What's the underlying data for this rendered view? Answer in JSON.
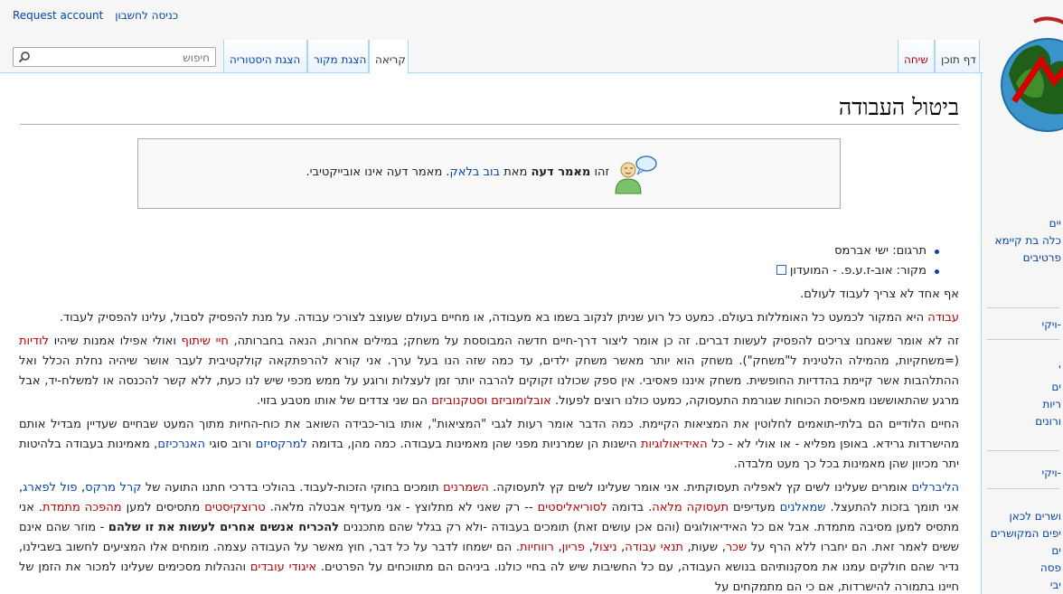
{
  "personal": {
    "login": "כניסה לחשבון",
    "request": "Request account"
  },
  "tabs": {
    "page": "דף תוכן",
    "talk": "שיחה",
    "read": "קריאה",
    "source": "הצגת מקור",
    "history": "הצגת היסטוריה"
  },
  "search": {
    "placeholder": "חיפוש"
  },
  "sidebar": {
    "items": [
      "יים",
      "כלה בת קיימא",
      "פרטיבים",
      "-ויקי",
      "'",
      "ים",
      "ריות",
      "ורונים",
      "-ויקי",
      "ושרים לכאן",
      "יפים המקושרים",
      "ים",
      "פסה",
      "יבי"
    ]
  },
  "article": {
    "title": "ביטול העבודה",
    "notice": {
      "prefix": "זהו",
      "bold": "מאמר דעה",
      "mid": "מאת",
      "author": "בוב בלאק",
      "suffix": ". מאמר דעה אינו אובייקטיבי."
    },
    "translation": "תרגום: ישי אברמס",
    "source": "מקור: אוב-ז.ע.פ. - המועדון",
    "p0": "אף אחד לא צריך לעבוד לעולם.",
    "p1": [
      {
        "t": "עבודה",
        "c": "red"
      },
      {
        "t": " היא המקור לכמעט כל האומללות בעולם. כמעט כל רוע שניתן לנקוב בשמו בא מעבודה, או מחיים בעולם שעוצב לצורכי עבודה. על מנת להפסיק לסבול, עלינו להפסיק לעבוד."
      }
    ],
    "p2": [
      {
        "t": "זה לא אומר שאנחנו צריכים להפסיק לעשות דברים. זה כן אומר ליצור דרך-חיים חדשה המבוססת על משחק; במילים אחרות, הנאה בחברותה, "
      },
      {
        "t": "חיי שיתוף",
        "c": "red"
      },
      {
        "t": " ואולי אפילו אמנות שיהיו "
      },
      {
        "t": "לודיות",
        "c": "red"
      },
      {
        "t": " (=משחקיות, מהמילה הלטינית ל\"משחק\"). משחק הוא יותר מאשר משחק ילדים, עד כמה שזה הנו בעל ערך. אני קורא להרפתקאה קולקטיבית לעבר אושר שיהיה נחלת הכלל ואל ההתלהבות אשר קיימת בהדדיות החופשית. משחק איננו פאסיבי. אין ספק שכולנו זקוקים להרבה יותר זמן לעצלות ורוגע על ממש מכפי שיש לנו כעת, ללא קשר להכנסה או למשלח-יד, אבל מרגע שהתאוששנו מאפיסת הכוחות שגורמת התעסוקה, כמעט כולנו רוצים לפעול. "
      },
      {
        "t": "אובלומוביזם וסטקנוביזם",
        "c": "red"
      },
      {
        "t": " הם שני צדדים של אותו מטבע בזוי."
      }
    ],
    "p3": [
      {
        "t": "החיים הלודיים הם בלתי-תואמים לחלוטין את המציאות הקיימת. כמה הדבר אומר רעות לגבי \"המציאות\", אותו בור-כבידה השואב את כוח-החיות מתוך המעט שבחיים שעדיין מבדיל אותם מהישרדות גרידא. באופן מפליא - או אולי לא - כל "
      },
      {
        "t": "האידיאולוגיות",
        "c": "red"
      },
      {
        "t": " הישנות הן שמרניות מפני שהן מאמינות בעבודה. כמה מהן, בדומה "
      },
      {
        "t": "למרקסיזם",
        "c": "link"
      },
      {
        "t": " ורוב סוגי "
      },
      {
        "t": "האנרכיזם",
        "c": "link"
      },
      {
        "t": ", מאמינות בעבודה בלהיטות יתר מכיוון שהן מאמינות בכל כך מעט מלבדה."
      }
    ],
    "p4": [
      {
        "t": "הליברלים",
        "c": "link"
      },
      {
        "t": " אומרים שעלינו לשים קץ לאפליה תעסוקתית. אני אומר שעלינו לשים קץ לתעסוקה. "
      },
      {
        "t": "השמרנים",
        "c": "red"
      },
      {
        "t": " תומכים בחוקי הזכות-לעבוד. בהולכי בדרכי חתנו התועה של "
      },
      {
        "t": "קרל מרקס",
        "c": "link"
      },
      {
        "t": ", "
      },
      {
        "t": "פול לפארג",
        "c": "link"
      },
      {
        "t": ", אני תומך בזכות להתעצל. "
      },
      {
        "t": "שמאלנים",
        "c": "link"
      },
      {
        "t": " מעדיפים "
      },
      {
        "t": "תעסוקה מלאה",
        "c": "red"
      },
      {
        "t": ". בדומה "
      },
      {
        "t": "לסוריאליסטים",
        "c": "red"
      },
      {
        "t": " -- רק שאני לא מתלוצץ - אני מעדיף אבטלה מלאה. "
      },
      {
        "t": "טרוצקיסטים",
        "c": "red"
      },
      {
        "t": " מתסיסים למען "
      },
      {
        "t": "מהפכה מתמדת",
        "c": "red"
      },
      {
        "t": ". אני מתסיס למען מסיבה מתמדת. אבל אם כל האידיאולוגים (והם אכן עושים זאת) תומכים בעבודה -ולא רק בגלל שהם מתכננים "
      },
      {
        "t": "להכריח אנשים אחרים לעשות את זו שלהם",
        "c": "bold"
      },
      {
        "t": " - מוזר שהם אינם ששים לאמר זאת. הם יחברו ללא הרף על "
      },
      {
        "t": "שכר",
        "c": "red"
      },
      {
        "t": ", שעות, "
      },
      {
        "t": "תנאי עבודה",
        "c": "red"
      },
      {
        "t": ", "
      },
      {
        "t": "ניצול",
        "c": "red"
      },
      {
        "t": ", "
      },
      {
        "t": "פריון",
        "c": "red"
      },
      {
        "t": ", "
      },
      {
        "t": "רווחיות",
        "c": "red"
      },
      {
        "t": ". הם ישמחו לדבר על כל דבר, חוץ מאשר על העבודה עצמה. מומחים אלו המציעים לחשוב בשבילנו, נדיר שהם חולקים עמנו את מסקנותיהם בנושא העבודה, עם כל החשיבות שיש לה בחיי כולנו. ביניהם הם מתווכחים על הפרטים. "
      },
      {
        "t": "איגודי עובדים",
        "c": "red"
      },
      {
        "t": " והנהלות מסכימים שעלינו למכור את הזמן של חיינו בתמורה להישרדות, אם כי הם מתמקחים על"
      }
    ]
  }
}
